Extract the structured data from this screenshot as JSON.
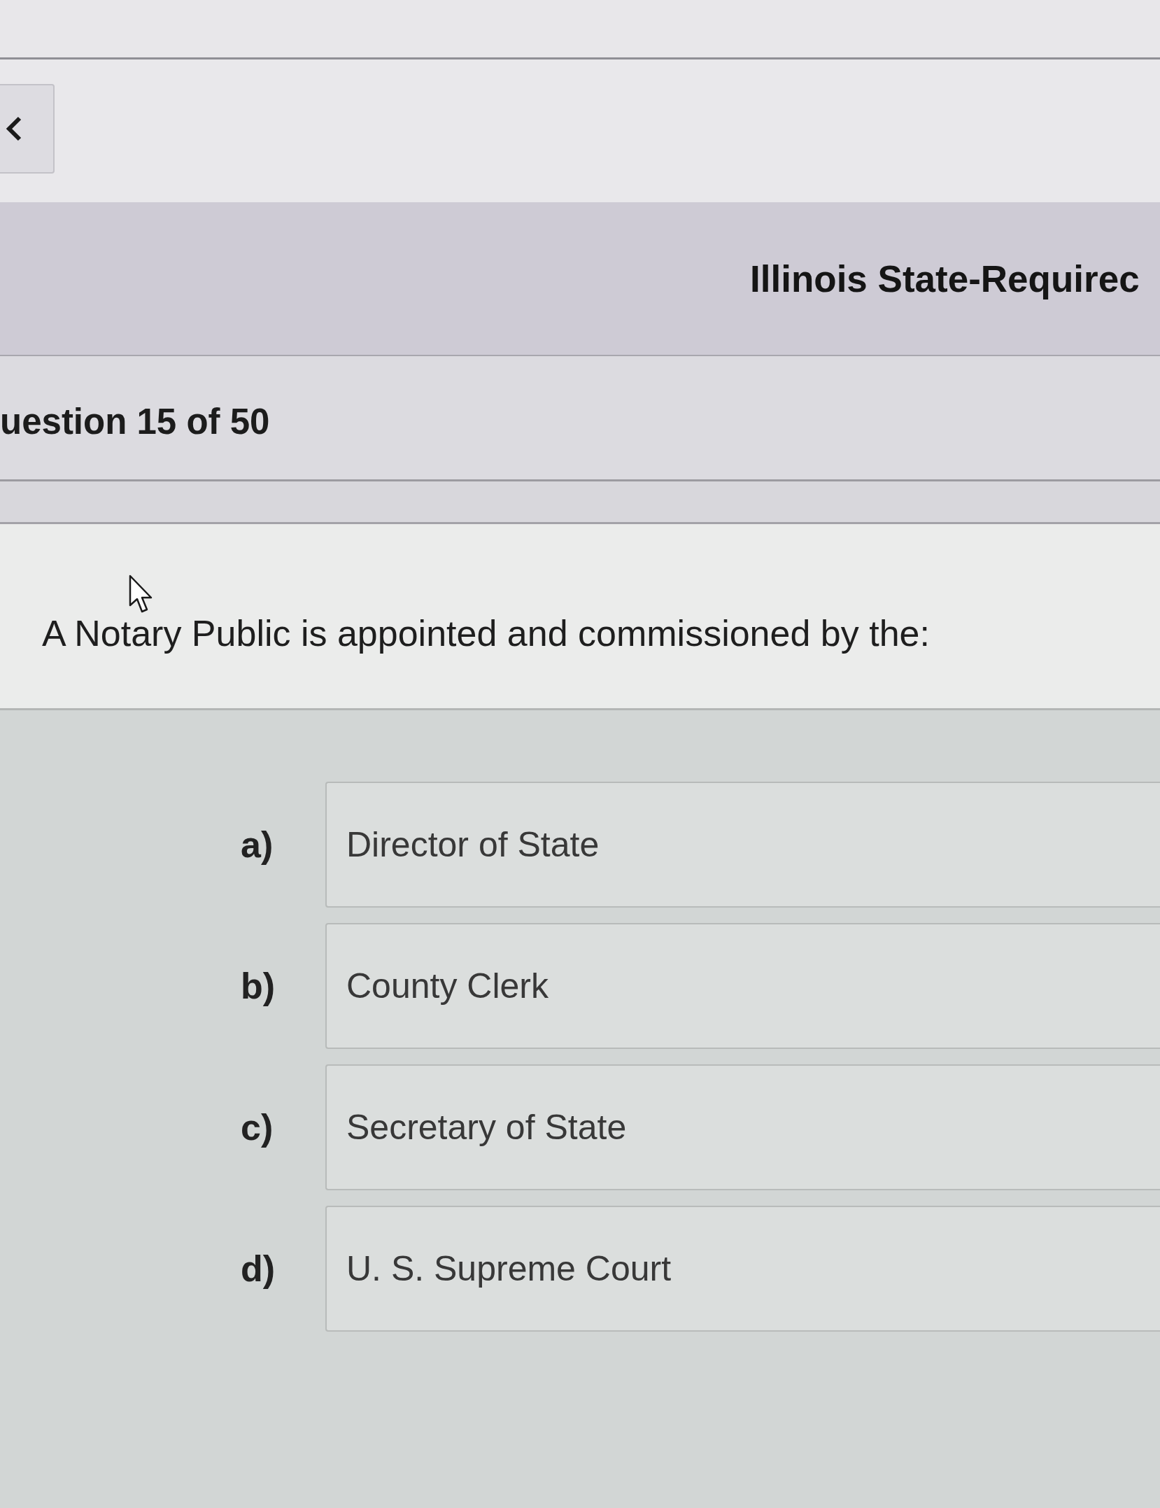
{
  "header": {
    "title": "Illinois State-Requirec"
  },
  "progress": {
    "label": "uestion 15 of 50"
  },
  "question": {
    "text": "A Notary Public is appointed and commissioned by the:"
  },
  "options": [
    {
      "letter": "a)",
      "text": "Director of State",
      "selected": false
    },
    {
      "letter": "b)",
      "text": "County Clerk",
      "selected": false
    },
    {
      "letter": "c)",
      "text": "Secretary of State",
      "selected": false
    },
    {
      "letter": "d)",
      "text": "U. S. Supreme Court",
      "selected": false
    }
  ]
}
